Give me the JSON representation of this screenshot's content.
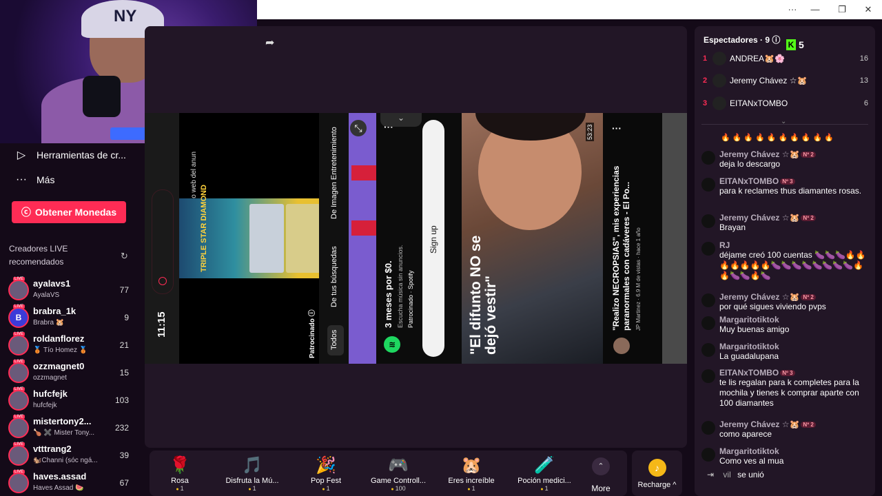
{
  "window": {
    "min": "—",
    "max": "❐",
    "close": "✕",
    "menu": "···"
  },
  "webcam": {
    "hat_logo": "NY"
  },
  "sidebar": {
    "tools_label": "Herramientas de cr...",
    "more_label": "Más",
    "coins_button": "Obtener Monedas",
    "recommended_title": "Creadores LIVE recomendados",
    "creators": [
      {
        "handle": "ayalavs1",
        "sub": "AyalaVS",
        "count": "77",
        "initial": ""
      },
      {
        "handle": "brabra_1k",
        "sub": "Brabra 🐹",
        "count": "9",
        "initial": "B"
      },
      {
        "handle": "roldanflorez",
        "sub": "🥉 Tío Homez 🥉",
        "count": "21",
        "initial": ""
      },
      {
        "handle": "ozzmagnet0",
        "sub": "ozzmagnet",
        "count": "15",
        "initial": ""
      },
      {
        "handle": "hufcfejk",
        "sub": "hufcfejk",
        "count": "103",
        "initial": ""
      },
      {
        "handle": "mistertony2...",
        "sub": "🍗 ✖️ Mister Tony...",
        "count": "232",
        "initial": ""
      },
      {
        "handle": "vtttrang2",
        "sub": "🐿️Channi (sóc ngá...",
        "count": "39",
        "initial": ""
      },
      {
        "handle": "haves.assad",
        "sub": "Haves Assad 🍉",
        "count": "67",
        "initial": ""
      }
    ]
  },
  "video": {
    "clock": "11:15",
    "side_ad": "Tránsito web del anun",
    "slot_title": "TRIPLE STAR DIAMOND",
    "sponsored": "Patrocinado ⓘ",
    "filter_all": "Todos",
    "filter_searches": "De tus búsquedas",
    "filter_image": "De Imagen Entretenimiento",
    "spotify_offer": "3 meses por $0.",
    "spotify_sub": "Escucha música sin anuncios.",
    "spotify_src": "Patrocinado · Spotify",
    "signup": "Sign up",
    "thumb_text": "\"El difunto NO se dejó vestir\"",
    "duration": "53:23",
    "video_title": "\"Realizo NECROPSIAS\", mis experiencias paranormales con cadáveres - El Po...",
    "video_channel": "JP Martinez · 6.9 M de vistas · hace 1 año"
  },
  "gifts": [
    {
      "icon": "🌹",
      "name": "Rosa",
      "price": "1"
    },
    {
      "icon": "🎵",
      "name": "Disfruta la Mú...",
      "price": "1"
    },
    {
      "icon": "🎉",
      "name": "Pop Fest",
      "price": "1"
    },
    {
      "icon": "🎮",
      "name": "Game Controll...",
      "price": "100"
    },
    {
      "icon": "🐹",
      "name": "Eres increíble",
      "price": "1"
    },
    {
      "icon": "🧪",
      "name": "Poción medici...",
      "price": "1"
    }
  ],
  "gift_more": "More",
  "recharge": "Recharge ^",
  "chat": {
    "viewers_title": "Espectadores · 9 ⓘ",
    "kick_count": "5",
    "top_viewers": [
      {
        "rank": "1",
        "name": "ANDREA🐹🌸",
        "score": "16"
      },
      {
        "rank": "2",
        "name": "Jeremy Chávez ☆🐹",
        "score": "13"
      },
      {
        "rank": "3",
        "name": "EITANxTOMBO",
        "score": "6"
      }
    ],
    "flames": "🔥🔥🔥🔥🔥🔥🔥🔥🔥🔥",
    "messages": [
      {
        "name": "Jeremy Chávez ☆🐹",
        "badge": "Nº 2",
        "text": "deja lo descargo"
      },
      {
        "name": "EITANxTOMBO",
        "badge": "Nº 3",
        "text": "para k reclames thus diamantes rosas."
      },
      {
        "name": "Jeremy Chávez ☆🐹",
        "badge": "Nº 2",
        "text": "Brayan"
      },
      {
        "name": "RJ",
        "badge": "",
        "text": "déjame creó 100 cuentas 🍆🍆🍆🔥🔥🔥🔥🔥🔥🔥🍆🍆🍆🍆🍆🍆🍆🍆🔥🔥🍆🍆🔥🍆"
      },
      {
        "name": "Jeremy Chávez ☆🐹",
        "badge": "Nº 2",
        "text": "por qué sigues viviendo pvps"
      },
      {
        "name": "Margaritotiktok",
        "badge": "",
        "text": "Muy buenas amigo"
      },
      {
        "name": "Margaritotiktok",
        "badge": "",
        "text": "La guadalupana"
      },
      {
        "name": "EITANxTOMBO",
        "badge": "Nº 3",
        "text": "te lis regalan para k completes para la mochila y tienes k comprar aparte con 100 diamantes"
      },
      {
        "name": "Jeremy Chávez ☆🐹",
        "badge": "Nº 2",
        "text": "como aparece"
      },
      {
        "name": "Margaritotiktok",
        "badge": "",
        "text": "Como ves al mua"
      }
    ],
    "joined_user": "vil",
    "joined_text": "se unió"
  }
}
